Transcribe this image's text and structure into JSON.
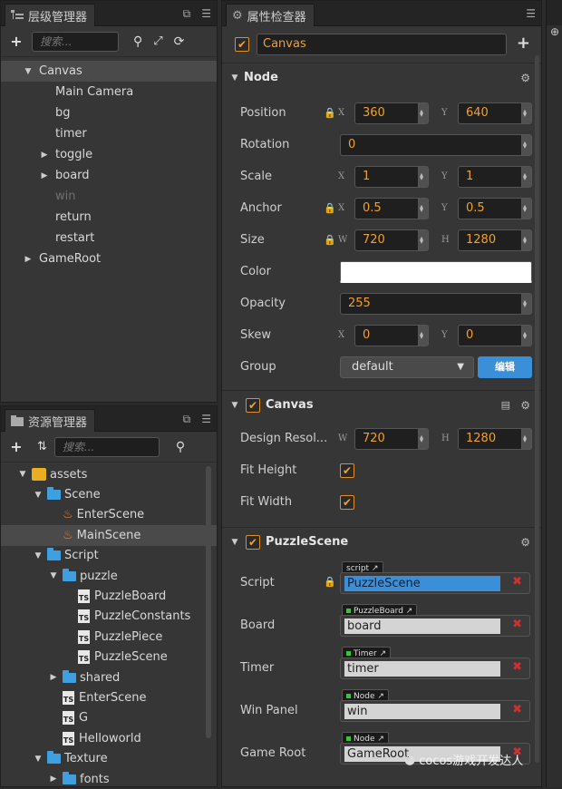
{
  "hierarchy": {
    "title": "层级管理器",
    "search_placeholder": "搜索...",
    "nodes": [
      {
        "label": "Canvas",
        "depth": 0,
        "expanded": true,
        "selected": true
      },
      {
        "label": "Main Camera",
        "depth": 1
      },
      {
        "label": "bg",
        "depth": 1
      },
      {
        "label": "timer",
        "depth": 1
      },
      {
        "label": "toggle",
        "depth": 1,
        "collapsed": true
      },
      {
        "label": "board",
        "depth": 1,
        "collapsed": true
      },
      {
        "label": "win",
        "depth": 1,
        "dimmed": true
      },
      {
        "label": "return",
        "depth": 1
      },
      {
        "label": "restart",
        "depth": 1
      },
      {
        "label": "GameRoot",
        "depth": 0,
        "collapsed": true
      }
    ]
  },
  "assets": {
    "title": "资源管理器",
    "search_placeholder": "搜索...",
    "tree": [
      {
        "label": "assets",
        "depth": 0,
        "icon": "package-icon",
        "expanded": true
      },
      {
        "label": "Scene",
        "depth": 1,
        "icon": "folder-icon",
        "expanded": true
      },
      {
        "label": "EnterScene",
        "depth": 2,
        "icon": "scene-icon"
      },
      {
        "label": "MainScene",
        "depth": 2,
        "icon": "scene-icon",
        "selected": true
      },
      {
        "label": "Script",
        "depth": 1,
        "icon": "folder-icon",
        "expanded": true
      },
      {
        "label": "puzzle",
        "depth": 2,
        "icon": "folder-icon",
        "expanded": true
      },
      {
        "label": "PuzzleBoard",
        "depth": 3,
        "icon": "ts-icon"
      },
      {
        "label": "PuzzleConstants",
        "depth": 3,
        "icon": "ts-icon"
      },
      {
        "label": "PuzzlePiece",
        "depth": 3,
        "icon": "ts-icon"
      },
      {
        "label": "PuzzleScene",
        "depth": 3,
        "icon": "ts-icon"
      },
      {
        "label": "shared",
        "depth": 2,
        "icon": "folder-icon",
        "collapsed": true
      },
      {
        "label": "EnterScene",
        "depth": 2,
        "icon": "ts-icon"
      },
      {
        "label": "G",
        "depth": 2,
        "icon": "ts-icon"
      },
      {
        "label": "Helloworld",
        "depth": 2,
        "icon": "ts-icon"
      },
      {
        "label": "Texture",
        "depth": 1,
        "icon": "folder-icon",
        "expanded": true
      },
      {
        "label": "fonts",
        "depth": 2,
        "icon": "folder-icon",
        "collapsed": true
      }
    ]
  },
  "inspector": {
    "title": "属性检查器",
    "node_name": "Canvas",
    "node_section": "Node",
    "position": {
      "label": "Position",
      "x": "360",
      "y": "640"
    },
    "rotation": {
      "label": "Rotation",
      "value": "0"
    },
    "scale": {
      "label": "Scale",
      "x": "1",
      "y": "1"
    },
    "anchor": {
      "label": "Anchor",
      "x": "0.5",
      "y": "0.5"
    },
    "size": {
      "label": "Size",
      "w": "720",
      "h": "1280"
    },
    "color": {
      "label": "Color",
      "value": "#ffffff"
    },
    "opacity": {
      "label": "Opacity",
      "value": "255"
    },
    "skew": {
      "label": "Skew",
      "x": "0",
      "y": "0"
    },
    "group": {
      "label": "Group",
      "value": "default",
      "edit": "编辑"
    },
    "canvas_section": "Canvas",
    "design_res": {
      "label": "Design Resol...",
      "w": "720",
      "h": "1280"
    },
    "fit_height": {
      "label": "Fit Height",
      "checked": true
    },
    "fit_width": {
      "label": "Fit Width",
      "checked": true
    },
    "puzzle_section": "PuzzleScene",
    "script": {
      "label": "Script",
      "tag": "script",
      "value": "PuzzleScene"
    },
    "board": {
      "label": "Board",
      "tag": "PuzzleBoard",
      "value": "board"
    },
    "timer": {
      "label": "Timer",
      "tag": "Timer",
      "value": "timer"
    },
    "win_panel": {
      "label": "Win Panel",
      "tag": "Node",
      "value": "win"
    },
    "game_root": {
      "label": "Game Root",
      "tag": "Node",
      "value": "GameRoot"
    },
    "axis_x": "X",
    "axis_y": "Y",
    "axis_w": "W",
    "axis_h": "H"
  },
  "watermark": "cocos游戏开发达人",
  "accent_color": "#f0a030"
}
